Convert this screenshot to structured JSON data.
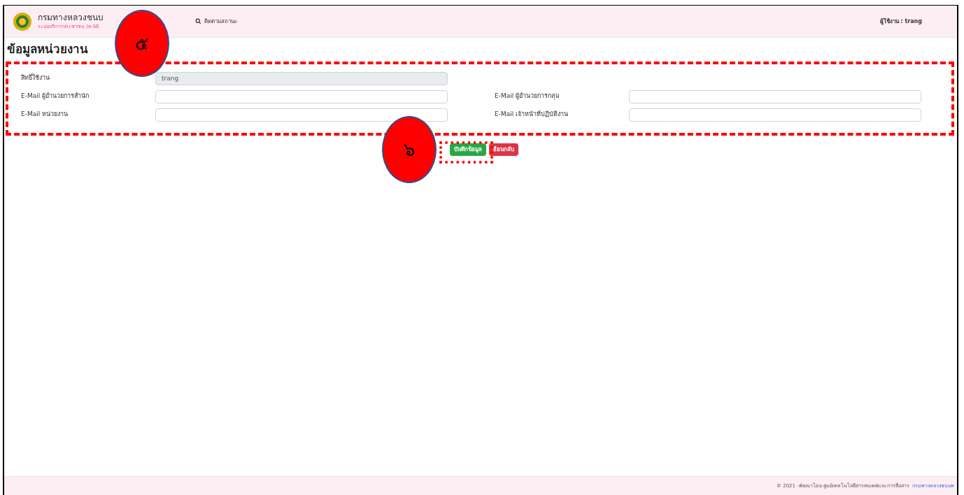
{
  "header": {
    "title": "กรมทางหลวงชนบ",
    "subtitle": "ระบบบริการประชาชน (e-SE",
    "nav": [
      {
        "label": "ติดตามสถานะ"
      }
    ],
    "user": "ผู้ใช้งาน : trang"
  },
  "page_title": "ข้อมูลหน่วยงาน",
  "form": {
    "rows": [
      [
        {
          "label": "สิทธิ์ใช้งาน",
          "value": "trang",
          "disabled": true
        }
      ],
      [
        {
          "label": "E-Mail ผู้อำนวยการสำนัก",
          "disabled": false
        },
        {
          "label": "E-Mail ผู้อำนวยการกลุ่ม",
          "disabled": false
        }
      ],
      [
        {
          "label": "E-Mail หน่วยงาน",
          "disabled": false
        },
        {
          "label": "E-Mail เจ้าหน้าที่ปฏิบัติงาน",
          "disabled": false
        }
      ]
    ]
  },
  "buttons": [
    {
      "label": "บันทึกข้อมูล",
      "kind": "save"
    },
    {
      "label": "ย้อนกลับ",
      "kind": "back"
    }
  ],
  "annotations": [
    {
      "label": "๕"
    },
    {
      "label": "๖"
    }
  ],
  "footer": {
    "text": "© 2021 -พัฒนาโดย ศูนย์เทคโนโลยีสารสนเทศและการสื่อสาร",
    "link": "กรมทางหลวงชนบท"
  }
}
